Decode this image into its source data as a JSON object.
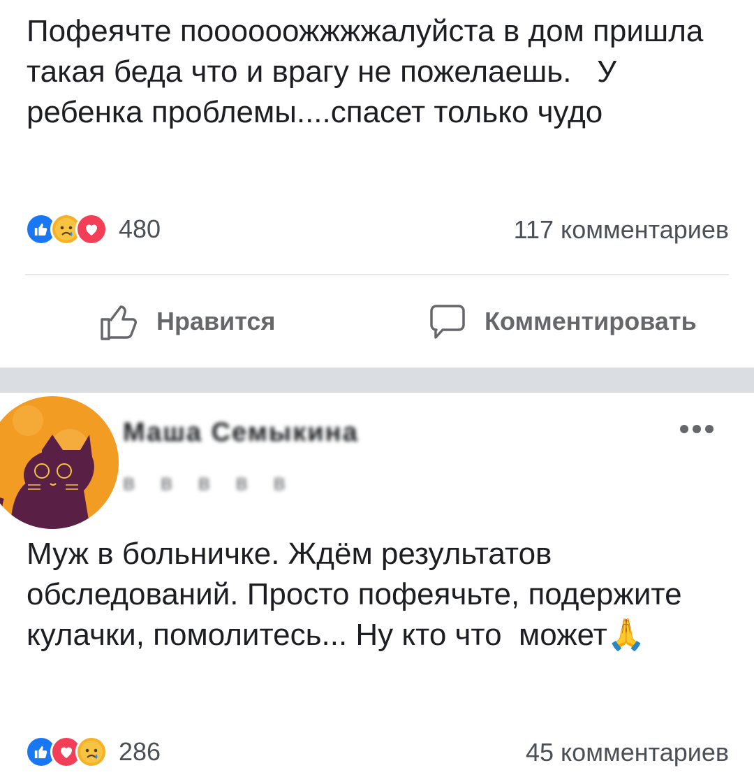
{
  "post1": {
    "text": "Пофеячте поооооожжжжалуйста в дом пришла такая беда что и врагу не пожелаешь.   У ребенка проблемы....спасет только чудо",
    "reactions": [
      "like-icon",
      "sad-icon",
      "love-icon"
    ],
    "reaction_count": "480",
    "comments": "117 комментариев",
    "actions": {
      "like": "Нравится",
      "comment": "Комментировать"
    }
  },
  "post2": {
    "author": {
      "name": "Маша Семыкина",
      "meta": "в в в в в"
    },
    "text": "Муж в больничке. Ждём результатов обследований. Просто пофеячьте, подержите кулачки, помолитесь... Ну кто что  может🙏",
    "reactions": [
      "like-icon",
      "love-icon",
      "sad-icon"
    ],
    "reaction_count": "286",
    "comments": "45 комментариев"
  },
  "colors": {
    "like": "#1877f2",
    "love": "#f33e58",
    "sad": "#f7b125",
    "separator": "#dadde1"
  }
}
